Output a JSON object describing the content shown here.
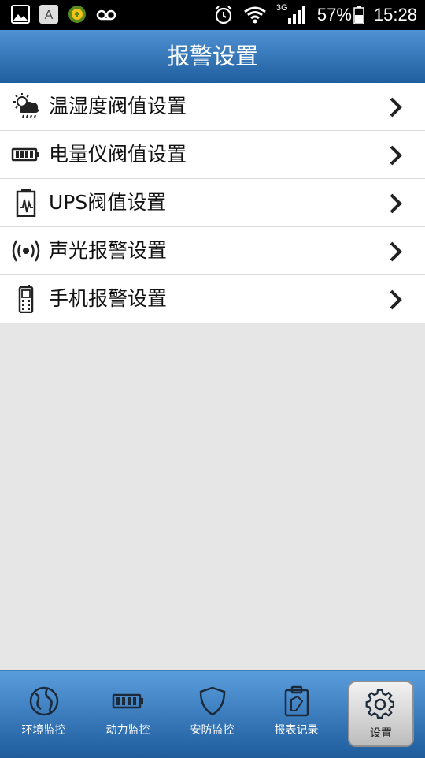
{
  "status_bar": {
    "battery": "57%",
    "time": "15:28",
    "network": "3G",
    "left_icons": [
      "gallery-icon",
      "a-icon",
      "app-icon",
      "voicemail-icon"
    ],
    "right_icons": [
      "alarm-icon",
      "wifi-icon",
      "signal-icon",
      "battery-icon"
    ]
  },
  "header": {
    "title": "报警设置"
  },
  "menu": {
    "items": [
      {
        "label": "温湿度阀值设置",
        "icon": "weather-icon"
      },
      {
        "label": "电量仪阀值设置",
        "icon": "battery-meter-icon"
      },
      {
        "label": "UPS阀值设置",
        "icon": "ups-icon"
      },
      {
        "label": "声光报警设置",
        "icon": "speaker-alarm-icon"
      },
      {
        "label": "手机报警设置",
        "icon": "mobile-phone-icon"
      }
    ]
  },
  "tabbar": {
    "tabs": [
      {
        "label": "环境监控",
        "icon": "globe-icon"
      },
      {
        "label": "动力监控",
        "icon": "battery-icon"
      },
      {
        "label": "安防监控",
        "icon": "shield-icon"
      },
      {
        "label": "报表记录",
        "icon": "clipboard-icon"
      },
      {
        "label": "设置",
        "icon": "gear-icon",
        "active": true
      }
    ]
  },
  "colors": {
    "header_top": "#4f92d3",
    "header_bottom": "#1f5e9f",
    "background": "#e6e6e6"
  }
}
